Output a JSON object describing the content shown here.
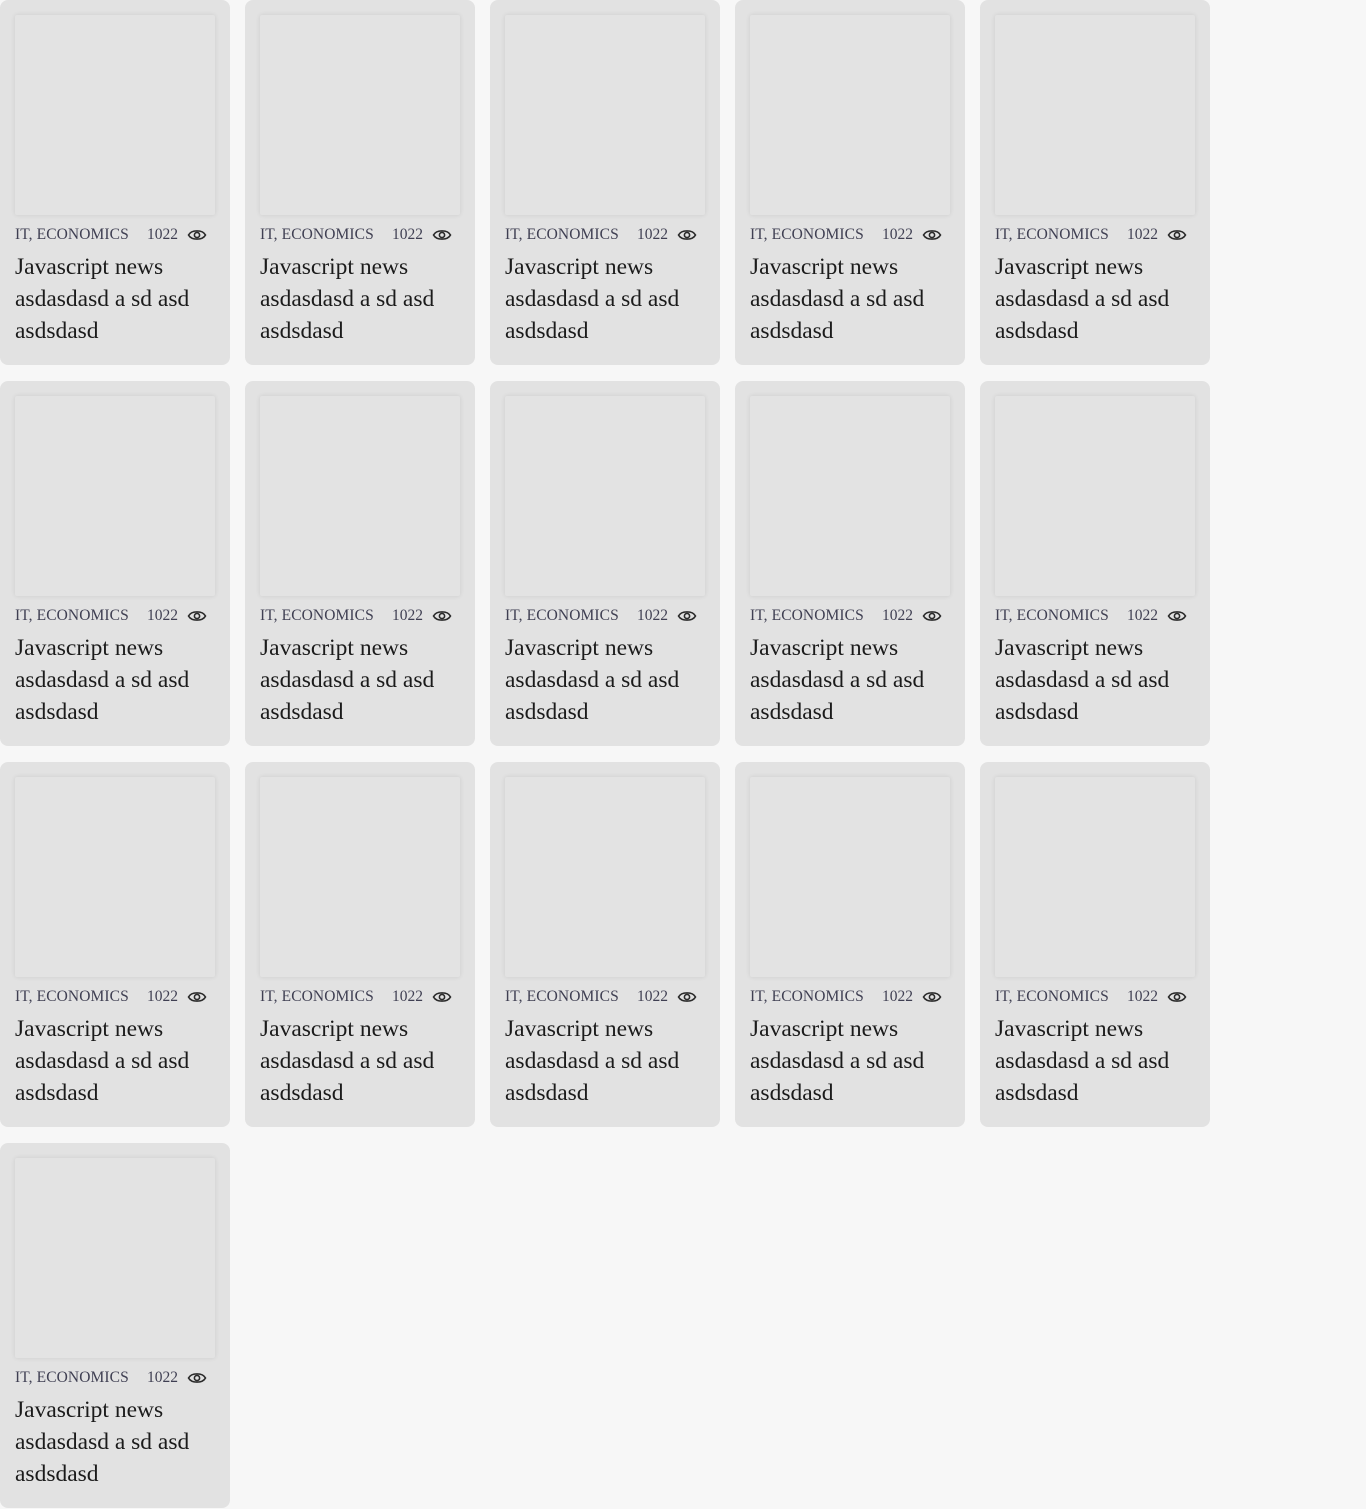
{
  "cards": [
    {
      "tags": "IT, ECONOMICS",
      "views": "1022",
      "title": "Javascript news asdasdasd a sd asd asdsdasd"
    },
    {
      "tags": "IT, ECONOMICS",
      "views": "1022",
      "title": "Javascript news asdasdasd a sd asd asdsdasd"
    },
    {
      "tags": "IT, ECONOMICS",
      "views": "1022",
      "title": "Javascript news asdasdasd a sd asd asdsdasd"
    },
    {
      "tags": "IT, ECONOMICS",
      "views": "1022",
      "title": "Javascript news asdasdasd a sd asd asdsdasd"
    },
    {
      "tags": "IT, ECONOMICS",
      "views": "1022",
      "title": "Javascript news asdasdasd a sd asd asdsdasd"
    },
    {
      "tags": "IT, ECONOMICS",
      "views": "1022",
      "title": "Javascript news asdasdasd a sd asd asdsdasd"
    },
    {
      "tags": "IT, ECONOMICS",
      "views": "1022",
      "title": "Javascript news asdasdasd a sd asd asdsdasd"
    },
    {
      "tags": "IT, ECONOMICS",
      "views": "1022",
      "title": "Javascript news asdasdasd a sd asd asdsdasd"
    },
    {
      "tags": "IT, ECONOMICS",
      "views": "1022",
      "title": "Javascript news asdasdasd a sd asd asdsdasd"
    },
    {
      "tags": "IT, ECONOMICS",
      "views": "1022",
      "title": "Javascript news asdasdasd a sd asd asdsdasd"
    },
    {
      "tags": "IT, ECONOMICS",
      "views": "1022",
      "title": "Javascript news asdasdasd a sd asd asdsdasd"
    },
    {
      "tags": "IT, ECONOMICS",
      "views": "1022",
      "title": "Javascript news asdasdasd a sd asd asdsdasd"
    },
    {
      "tags": "IT, ECONOMICS",
      "views": "1022",
      "title": "Javascript news asdasdasd a sd asd asdsdasd"
    },
    {
      "tags": "IT, ECONOMICS",
      "views": "1022",
      "title": "Javascript news asdasdasd a sd asd asdsdasd"
    },
    {
      "tags": "IT, ECONOMICS",
      "views": "1022",
      "title": "Javascript news asdasdasd a sd asd asdsdasd"
    },
    {
      "tags": "IT, ECONOMICS",
      "views": "1022",
      "title": "Javascript news asdasdasd a sd asd asdsdasd"
    }
  ],
  "icons": {
    "views": "eye-icon"
  },
  "colors": {
    "page_background": "#f7f7f7",
    "card_background": "#e2e2e2",
    "meta_text": "#3f3f52",
    "title_text": "#1b1b1b"
  }
}
